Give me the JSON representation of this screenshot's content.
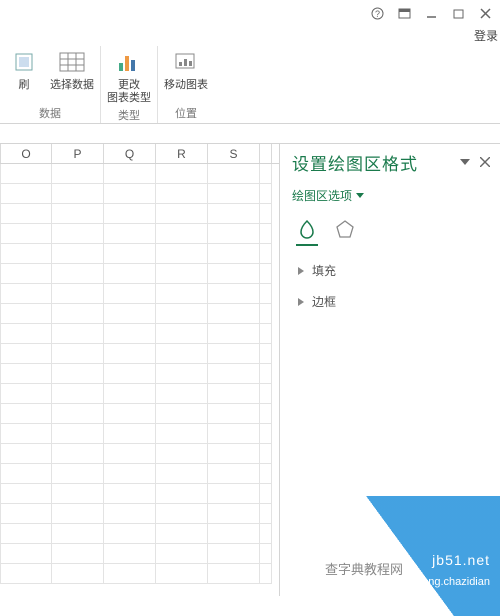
{
  "titlebar": {
    "signin": "登录"
  },
  "ribbon": {
    "groups": [
      {
        "label": "数据",
        "items": [
          {
            "label": "刷",
            "icon": "refresh"
          },
          {
            "label": "选择数据",
            "icon": "select-data"
          }
        ]
      },
      {
        "label": "类型",
        "items": [
          {
            "label": "更改\n图表类型",
            "icon": "change-chart-type"
          }
        ]
      },
      {
        "label": "位置",
        "items": [
          {
            "label": "移动图表",
            "icon": "move-chart"
          }
        ]
      }
    ]
  },
  "grid": {
    "columns": [
      "O",
      "P",
      "Q",
      "R",
      "S"
    ],
    "row_count": 21
  },
  "pane": {
    "title": "设置绘图区格式",
    "subtitle": "绘图区选项",
    "tabs": [
      "fill-line",
      "effects"
    ],
    "sections": [
      "填充",
      "边框"
    ]
  },
  "watermark": {
    "line1": "查字典教程网",
    "line2": "jiaocheng.chazidian",
    "brand": "jb51.net"
  }
}
